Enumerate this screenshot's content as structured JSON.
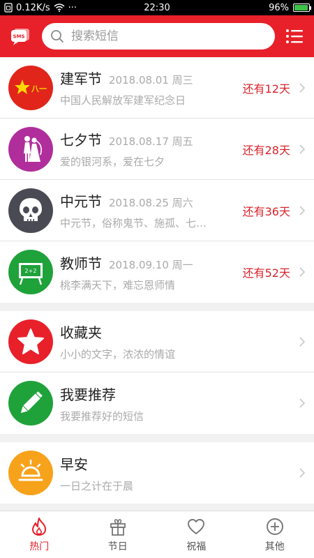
{
  "status_bar": {
    "speed": "0.12K/s",
    "more": "···",
    "time": "22:30",
    "battery_percent": "96%",
    "battery_level": 0.96
  },
  "header": {
    "logo_text": "SMS",
    "search_placeholder": "搜索短信"
  },
  "holidays": [
    {
      "title": "建军节",
      "date": "2018.08.01 周三",
      "subtitle": "中国人民解放军建军纪念日",
      "countdown": "还有12天",
      "avatar_text": "八一",
      "icon": "star-flag-icon"
    },
    {
      "title": "七夕节",
      "date": "2018.08.17 周五",
      "subtitle": "爱的银河系，爱在七夕",
      "countdown": "还有28天",
      "icon": "couple-icon"
    },
    {
      "title": "中元节",
      "date": "2018.08.25 周六",
      "subtitle": "中元节，俗称鬼节、施孤、七…",
      "countdown": "还有36天",
      "icon": "skull-icon"
    },
    {
      "title": "教师节",
      "date": "2018.09.10 周一",
      "subtitle": "桃李满天下，难忘恩师情",
      "countdown": "还有52天",
      "avatar_text": "2+2",
      "icon": "blackboard-icon"
    }
  ],
  "features": [
    {
      "title": "收藏夹",
      "subtitle": "小小的文字，浓浓的情谊",
      "icon": "star-icon"
    },
    {
      "title": "我要推荐",
      "subtitle": "我要推荐好的短信",
      "icon": "pencil-icon"
    }
  ],
  "categories": [
    {
      "title": "早安",
      "subtitle": "一日之计在于晨",
      "icon": "sunrise-icon"
    }
  ],
  "bottom_nav": [
    {
      "label": "热门",
      "icon": "flame-icon",
      "active": true
    },
    {
      "label": "节日",
      "icon": "gift-icon",
      "active": false
    },
    {
      "label": "祝福",
      "icon": "heart-icon",
      "active": false
    },
    {
      "label": "其他",
      "icon": "plus-circle-icon",
      "active": false
    }
  ],
  "colors": {
    "brand_red": "#e8202a",
    "countdown_red": "#d9232b",
    "army_red": "#e1251b",
    "qixi_magenta": "#b02e9b",
    "ghost_gray": "#4a4a55",
    "teacher_green": "#1fa23a",
    "favorite_red": "#e8202a",
    "recommend_green": "#1fa23a",
    "morning_orange": "#f7a21b"
  }
}
